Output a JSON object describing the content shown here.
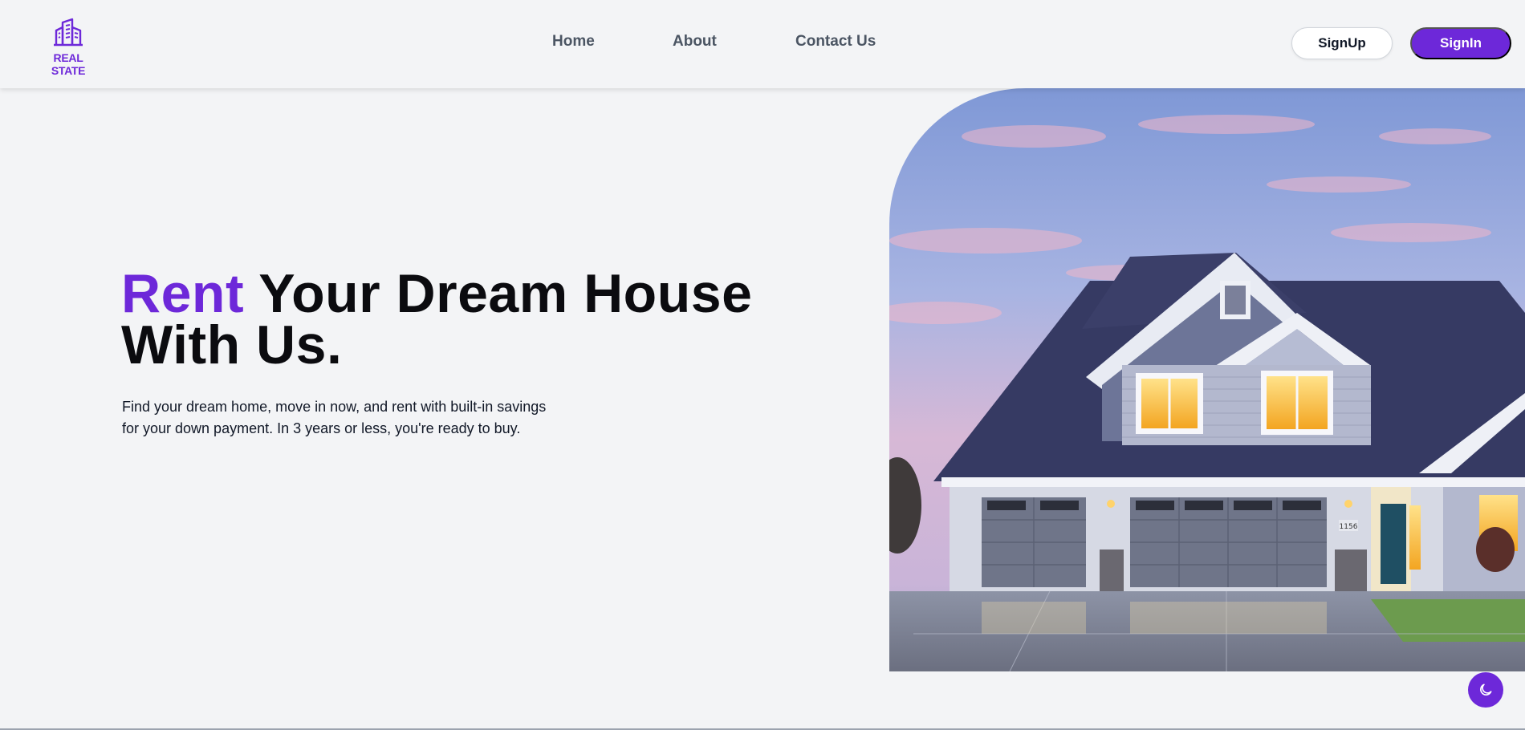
{
  "brand": {
    "name": "REAL STATE",
    "logo_icon": "buildings-icon",
    "color": "#6d28d9"
  },
  "nav": {
    "items": [
      {
        "label": "Home"
      },
      {
        "label": "About"
      },
      {
        "label": "Contact Us"
      }
    ]
  },
  "auth": {
    "signup_label": "SignUp",
    "signin_label": "SignIn"
  },
  "hero": {
    "title_accent": "Rent",
    "title_rest_line1": " Your Dream House",
    "title_line2": "With Us.",
    "description": "Find your dream home, move in now, and rent with built-in savings for your down payment. In 3 years or less, you're ready to buy.",
    "image": "house-photo",
    "house_number": "1156"
  },
  "theme_toggle": {
    "icon": "moon-icon"
  },
  "colors": {
    "accent": "#6d28d9",
    "background": "#f3f4f6",
    "text": "#0b0b0f"
  }
}
